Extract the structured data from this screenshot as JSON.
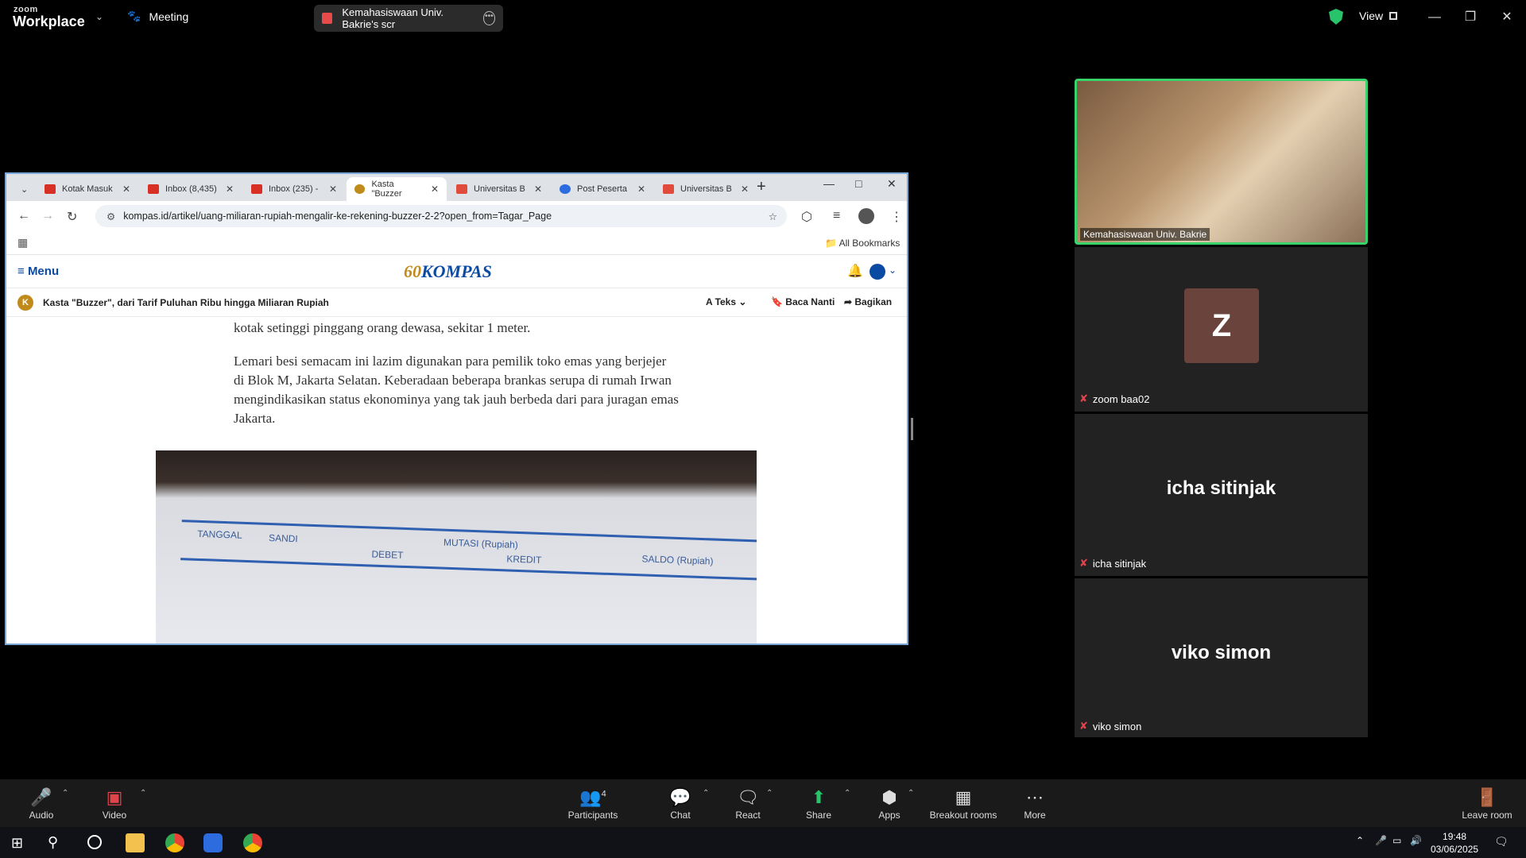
{
  "zoom": {
    "logo_top": "zoom",
    "logo_bottom": "Workplace",
    "meeting_label": "Meeting",
    "share_title": "Kemahasiswaan Univ. Bakrie's scr",
    "view_label": "View"
  },
  "browser": {
    "tabs": [
      {
        "label": "Kotak Masuk",
        "color": "#d93025"
      },
      {
        "label": "Inbox (8,435)",
        "color": "#d93025"
      },
      {
        "label": "Inbox (235) -",
        "color": "#d93025"
      },
      {
        "label": "Kasta \"Buzzer",
        "color": "#c08b1a"
      },
      {
        "label": "Universitas B",
        "color": "#e04b3b"
      },
      {
        "label": "Post Peserta",
        "color": "#2d6cdf"
      },
      {
        "label": "Universitas B",
        "color": "#e04b3b"
      }
    ],
    "url": "kompas.id/artikel/uang-miliaran-rupiah-mengalir-ke-rekening-buzzer-2-2?open_from=Tagar_Page",
    "all_bookmarks": "All Bookmarks"
  },
  "kompas": {
    "menu": "Menu",
    "logo": "KOMPAS",
    "logo_prefix": "60",
    "article_badge": "K",
    "article_title": "Kasta \"Buzzer\", dari Tarif Puluhan Ribu hingga Miliaran Rupiah",
    "teks": "Teks",
    "baca_nanti": "Baca Nanti",
    "bagikan": "Bagikan",
    "para1": "kotak setinggi pinggang orang dewasa, sekitar 1 meter.",
    "para2": "Lemari besi semacam ini lazim digunakan para pemilik toko emas yang berjejer di Blok M, Jakarta Selatan. Keberadaan beberapa brankas serupa di rumah Irwan mengindikasikan status ekonominya yang tak jauh berbeda dari para juragan emas Jakarta.",
    "photo": {
      "tanggal": "TANGGAL",
      "sandi": "SANDI",
      "mutasi": "MUTASI (Rupiah)",
      "debet": "DEBET",
      "kredit": "KREDIT",
      "saldo": "SALDO (Rupiah)"
    }
  },
  "participants": {
    "video_name": "Kemahasiswaan Univ. Bakrie",
    "z_initial": "Z",
    "z_label": "zoom baa02",
    "icha_big": "icha sitinjak",
    "icha_label": "icha sitinjak",
    "viko_big": "viko simon",
    "viko_label": "viko simon"
  },
  "toolbar": {
    "audio": "Audio",
    "video": "Video",
    "participants": "Participants",
    "participants_count": "4",
    "chat": "Chat",
    "react": "React",
    "share": "Share",
    "apps": "Apps",
    "breakout": "Breakout rooms",
    "more": "More",
    "leave": "Leave room"
  },
  "taskbar": {
    "time": "19:48",
    "date": "03/06/2025"
  }
}
